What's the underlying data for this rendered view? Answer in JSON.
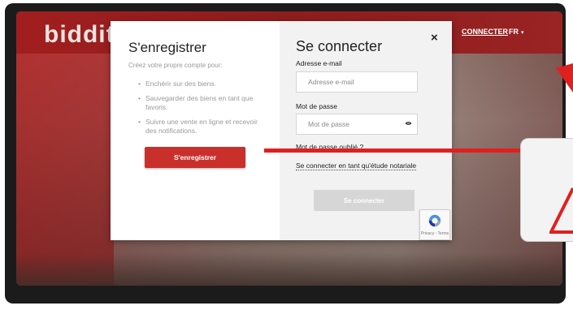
{
  "site": {
    "brand": "biddit",
    "nav_connect": "CONNECTER",
    "nav_lang": "FR"
  },
  "register": {
    "title": "S'enregistrer",
    "subtitle": "Créez votre propre compte pour:",
    "benefits": [
      "Enchérir sur des biens.",
      "Sauvegarder des biens en tant que favoris.",
      "Suivre une vente en ligne et recevoir des notifications."
    ],
    "button_label": "S'enregistrer"
  },
  "login": {
    "title": "Se connecter",
    "close_symbol": "×",
    "email_label": "Adresse e-mail",
    "email_placeholder": "Adresse e-mail",
    "password_label": "Mot de passe",
    "password_placeholder": "Mot de passe",
    "forgot_label": "Mot de passe oublié ?",
    "notary_label": "Se connecter en tant qu'étude notariale",
    "button_label": "Se connecter"
  },
  "recaptcha": {
    "footer": "Privacy - Terms"
  },
  "colors": {
    "brand_red": "#c9302c",
    "annotation_red": "#e01f1f",
    "disabled_button": "#d6d6d6"
  },
  "icons": {
    "close": "close-icon",
    "eye": "eye-icon",
    "recaptcha": "recaptcha-icon",
    "warning": "warning-triangle-icon",
    "caret": "chevron-down-icon"
  }
}
